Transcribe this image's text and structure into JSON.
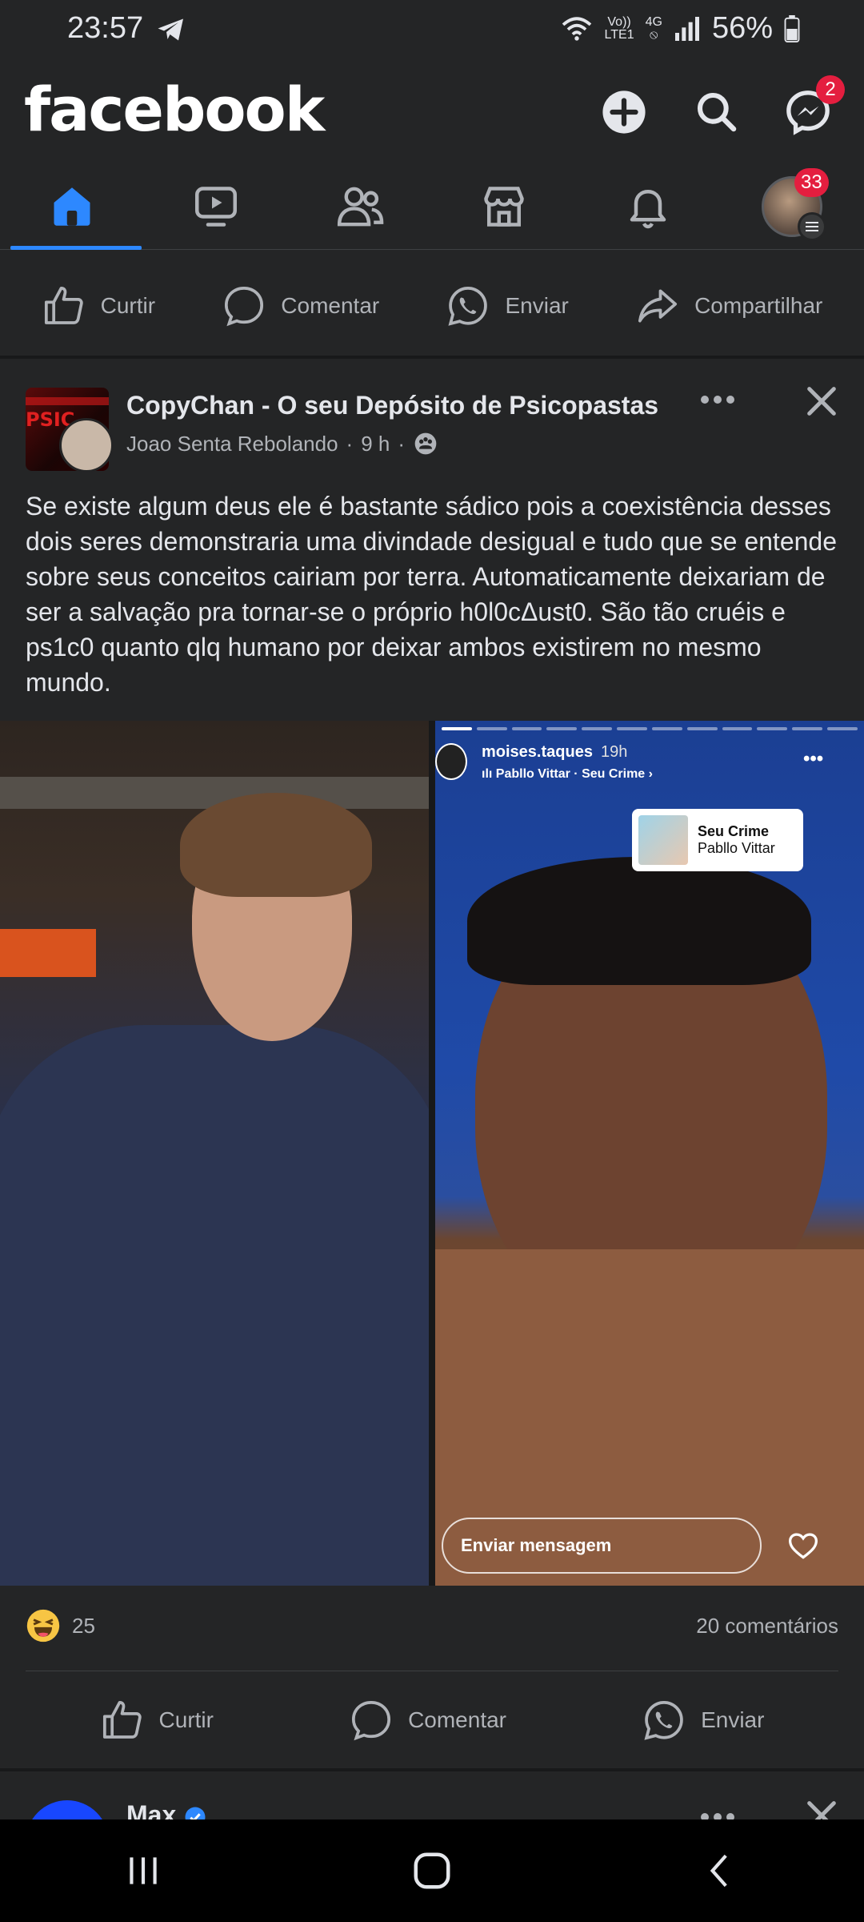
{
  "status_bar": {
    "time": "23:57",
    "battery": "56%",
    "net_top": "Vo))",
    "net_bottom": "LTE1",
    "net_gen": "4G"
  },
  "header": {
    "logo": "facebook",
    "messenger_badge": "2"
  },
  "nav": {
    "profile_badge": "33"
  },
  "top_actions": {
    "like": "Curtir",
    "comment": "Comentar",
    "send": "Enviar",
    "share": "Compartilhar"
  },
  "post": {
    "page_name": "CopyChan - O seu Depósito de Psicopastas",
    "author": "Joao Senta Rebolando",
    "time": "9 h",
    "text": "Se existe algum deus ele é bastante sádico pois a coexistência desses dois seres demonstraria uma divindade desigual e tudo que se entende sobre seus conceitos cairiam por terra. Automaticamente deixariam de ser a salvação pra tornar-se o próprio h0l0cΔust0. São tão cruéis e ps1c0 quanto qlq humano por deixar ambos existirem no mesmo mundo.",
    "story": {
      "username": "moises.taques",
      "time": "19h",
      "song": "Pabllo Vittar · Seu Crime ›",
      "sticker_title": "Seu Crime",
      "sticker_artist": "Pabllo Vittar",
      "message_placeholder": "Enviar mensagem"
    },
    "reaction_count": "25",
    "comments": "20 comentários",
    "actions": {
      "like": "Curtir",
      "comment": "Comentar",
      "send": "Enviar"
    }
  },
  "next_post": {
    "name": "Max"
  },
  "colors": {
    "background": "#242526",
    "accent": "#2d88ff",
    "badge": "#e41e3f",
    "secondary_text": "#b0b3b8"
  }
}
